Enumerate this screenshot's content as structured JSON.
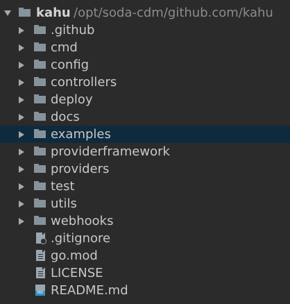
{
  "project_tree": {
    "root": {
      "name": "kahu",
      "path": "/opt/soda-cdm/github.com/kahu",
      "expanded": true
    },
    "folders": [
      {
        "label": ".github"
      },
      {
        "label": "cmd"
      },
      {
        "label": "config"
      },
      {
        "label": "controllers"
      },
      {
        "label": "deploy"
      },
      {
        "label": "docs"
      },
      {
        "label": "examples",
        "selected": true
      },
      {
        "label": "providerframework"
      },
      {
        "label": "providers"
      },
      {
        "label": "test"
      },
      {
        "label": "utils"
      },
      {
        "label": "webhooks"
      }
    ],
    "files": [
      {
        "label": ".gitignore",
        "icon": "gitignore-file-icon"
      },
      {
        "label": "go.mod",
        "icon": "text-file-icon"
      },
      {
        "label": "LICENSE",
        "icon": "text-file-icon"
      },
      {
        "label": "README.md",
        "icon": "markdown-file-icon"
      }
    ],
    "colors": {
      "background": "#2b2b2b",
      "selection": "#0f2a3d",
      "folder_icon": "#87939a",
      "text": "#c8c8c8",
      "path_text": "#8c8c8c"
    }
  }
}
